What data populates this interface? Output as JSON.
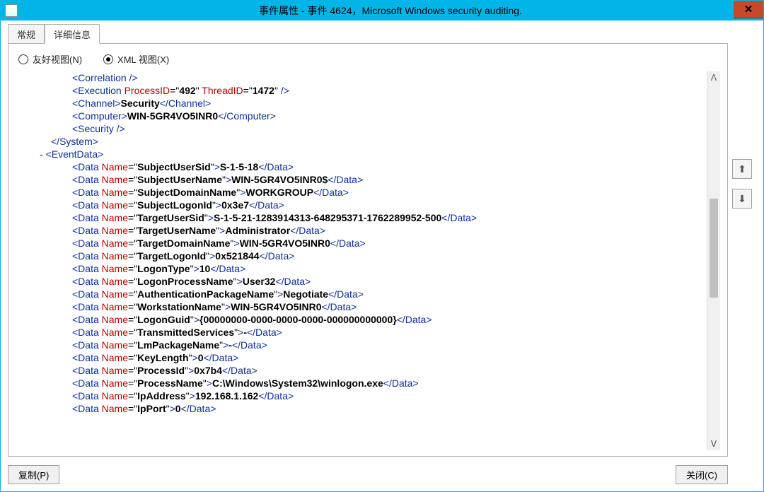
{
  "window": {
    "title": "事件属性 - 事件 4624，Microsoft Windows security auditing.",
    "close_label": "✕"
  },
  "tabs": {
    "general": "常规",
    "details": "详细信息"
  },
  "view": {
    "friendly": "友好视图(N)",
    "xml": "XML 视图(X)"
  },
  "buttons": {
    "copy": "复制(P)",
    "close": "关闭(C)"
  },
  "nav": {
    "up": "⬆",
    "down": "⬇"
  },
  "xml": {
    "correlation": "Correlation",
    "execution": {
      "tag": "Execution",
      "pidAttr": "ProcessID",
      "pid": "492",
      "tidAttr": "ThreadID",
      "tid": "1472"
    },
    "channel": {
      "tag": "Channel",
      "val": "Security"
    },
    "computer": {
      "tag": "Computer",
      "val": "WIN-5GR4VO5INR0"
    },
    "security": "Security",
    "systemClose": "System",
    "eventData": "EventData",
    "dataTag": "Data",
    "nameAttr": "Name",
    "items": [
      {
        "name": "SubjectUserSid",
        "val": "S-1-5-18"
      },
      {
        "name": "SubjectUserName",
        "val": "WIN-5GR4VO5INR0$"
      },
      {
        "name": "SubjectDomainName",
        "val": "WORKGROUP"
      },
      {
        "name": "SubjectLogonId",
        "val": "0x3e7"
      },
      {
        "name": "TargetUserSid",
        "val": "S-1-5-21-1283914313-648295371-1762289952-500"
      },
      {
        "name": "TargetUserName",
        "val": "Administrator"
      },
      {
        "name": "TargetDomainName",
        "val": "WIN-5GR4VO5INR0"
      },
      {
        "name": "TargetLogonId",
        "val": "0x521844"
      },
      {
        "name": "LogonType",
        "val": "10"
      },
      {
        "name": "LogonProcessName",
        "val": "User32"
      },
      {
        "name": "AuthenticationPackageName",
        "val": "Negotiate"
      },
      {
        "name": "WorkstationName",
        "val": "WIN-5GR4VO5INR0"
      },
      {
        "name": "LogonGuid",
        "val": "{00000000-0000-0000-0000-000000000000}"
      },
      {
        "name": "TransmittedServices",
        "val": "-"
      },
      {
        "name": "LmPackageName",
        "val": "-"
      },
      {
        "name": "KeyLength",
        "val": "0"
      },
      {
        "name": "ProcessId",
        "val": "0x7b4"
      },
      {
        "name": "ProcessName",
        "val": "C:\\Windows\\System32\\winlogon.exe"
      },
      {
        "name": "IpAddress",
        "val": "192.168.1.162"
      },
      {
        "name": "IpPort",
        "val": "0"
      }
    ]
  }
}
